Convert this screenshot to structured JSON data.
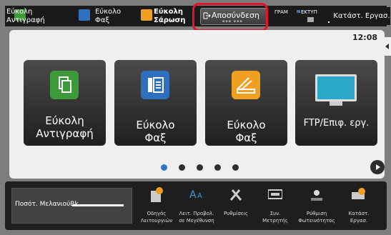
{
  "topbar": {
    "easy_copy": "Εύκολη\nΑντιγραφή",
    "easy_fax": "Εύκολο\nΦαξ",
    "easy_scan": "Εύκολη\nΣάρωση",
    "logout": "Αποσύνδεση",
    "tab_small_1": "ΓΡΑΜ",
    "tab_small_2": "ΕΚΤΥΠ",
    "status": "Κατάστ. Εργασ."
  },
  "clock": "12:08",
  "cards": [
    {
      "label": "Εύκολη\nΑντιγραφή",
      "icon": "copy-icon",
      "color": "#3d9a3a"
    },
    {
      "label": "Εύκολο\nΦαξ",
      "icon": "fax-icon",
      "color": "#2f6fc0"
    },
    {
      "label": "Εύκολο\nΦαξ",
      "icon": "scan-icon",
      "color": "#f0a020"
    },
    {
      "label": "FTP/Επιφ. εργ.",
      "icon": "monitor-icon",
      "color": "#2aa7c9"
    }
  ],
  "pagination": {
    "count": 5,
    "active": 0
  },
  "bottombar": {
    "toner": "Ποσότ. ΜελανιούBk",
    "items": [
      {
        "label": "Οδηγός\nΛειτουργιών",
        "icon": "guide-icon"
      },
      {
        "label": "Λειτ. Προβολ.\nσε Μεγέθυνση",
        "icon": "magnify-icon"
      },
      {
        "label": "Ρυθμίσεις",
        "icon": "settings-icon"
      },
      {
        "label": "Συν.\nΜετρητής",
        "icon": "counter-icon"
      },
      {
        "label": "Ρύθμιση\nΦωτεινότητας",
        "icon": "brightness-icon"
      },
      {
        "label": "Κατάστ.\nΕργασ.",
        "icon": "job-status-icon"
      }
    ]
  },
  "colors": {
    "highlight": "#e3142a",
    "accent": "#2f74c8"
  }
}
